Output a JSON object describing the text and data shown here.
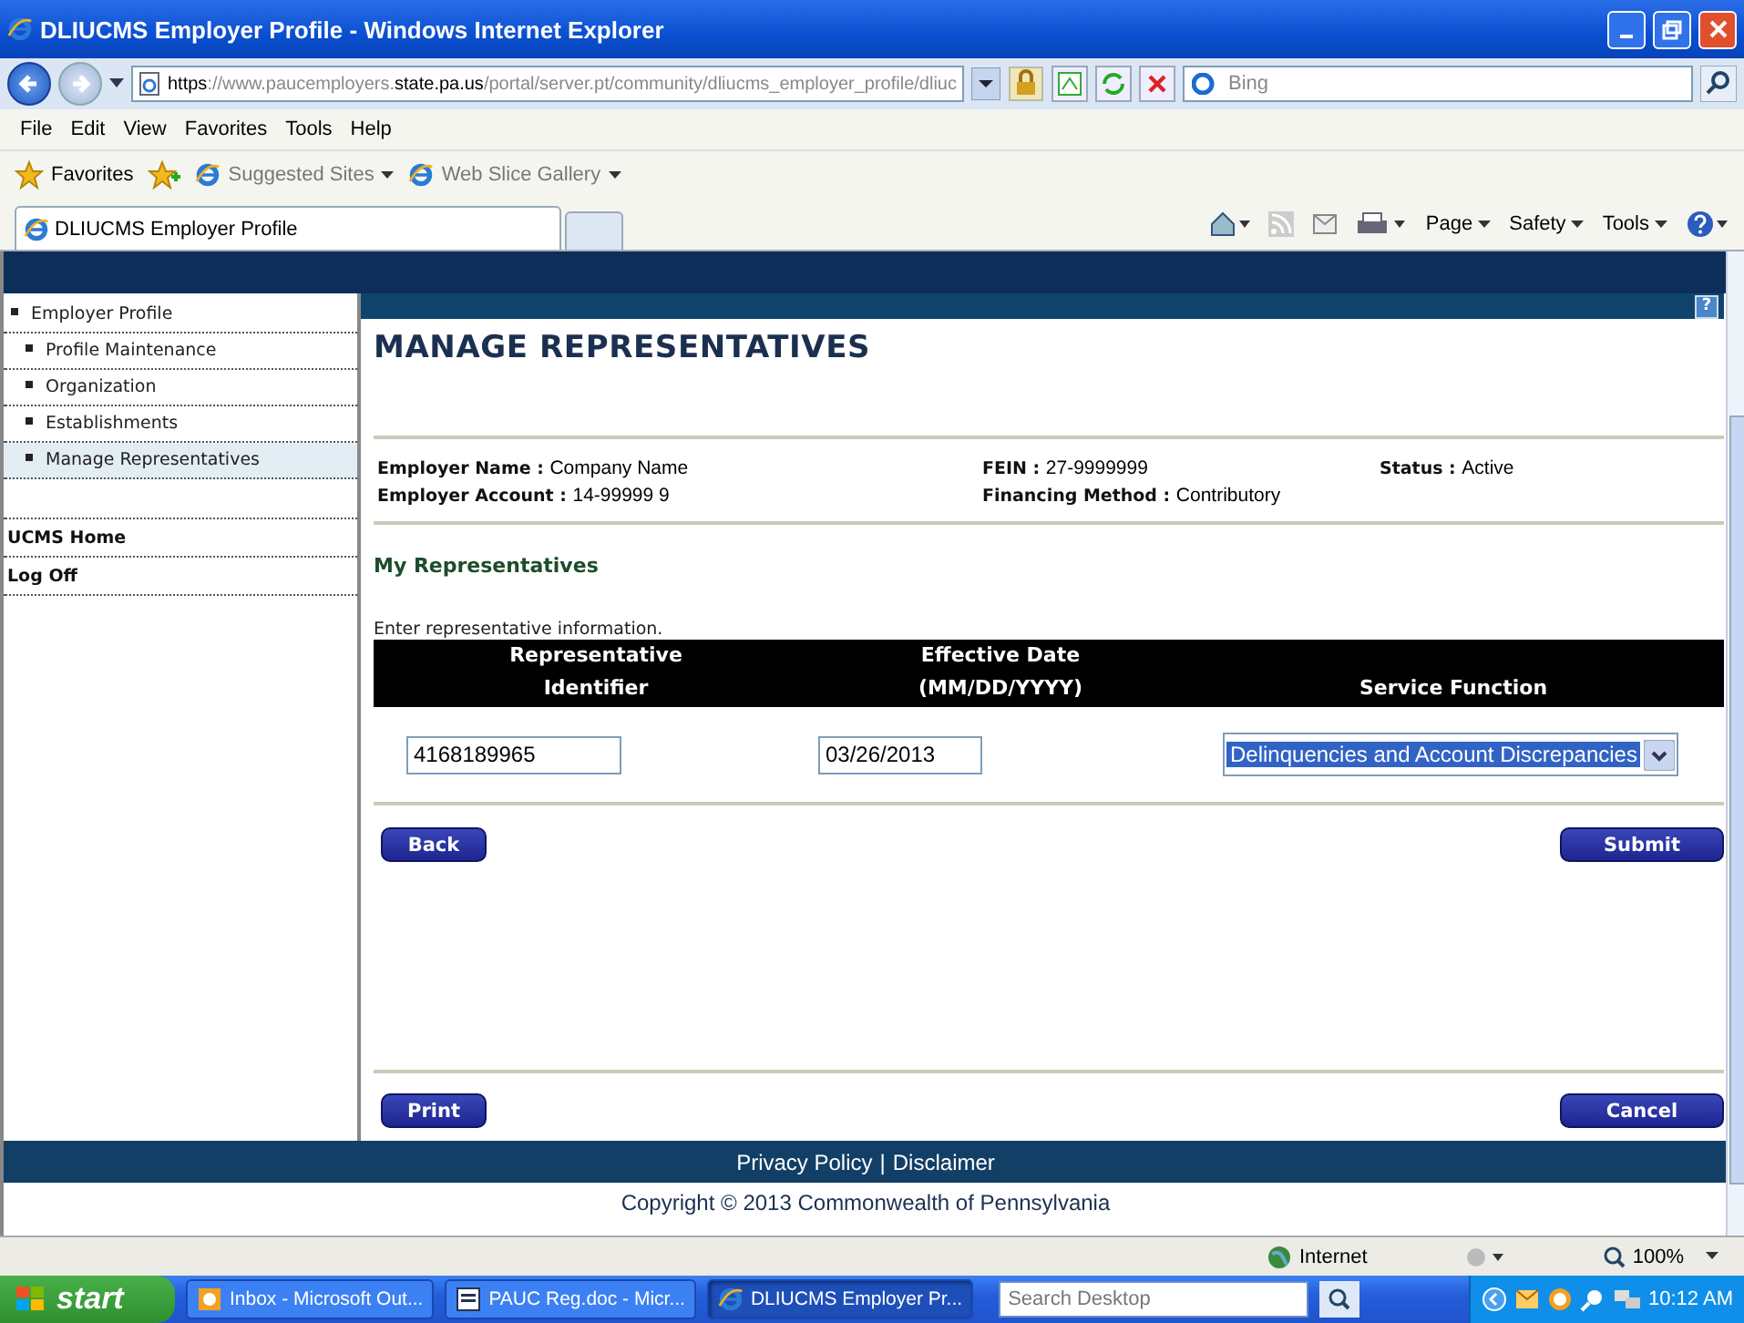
{
  "window": {
    "title": "DLIUCMS Employer Profile - Windows Internet Explorer"
  },
  "address_bar": {
    "url": [
      {
        "text": "https",
        "emphasis": true
      },
      {
        "text": "://www.paucemployers.",
        "emphasis": false
      },
      {
        "text": "state.pa.us",
        "emphasis": true
      },
      {
        "text": "/portal/server.pt/community/dliucms_employer_profile/dliuc",
        "emphasis": false
      }
    ],
    "search_placeholder": "Bing"
  },
  "menu": [
    "File",
    "Edit",
    "View",
    "Favorites",
    "Tools",
    "Help"
  ],
  "favorites_bar": {
    "label": "Favorites",
    "links": [
      "Suggested Sites",
      "Web Slice Gallery"
    ]
  },
  "tabs": [
    {
      "label": "DLIUCMS Employer Profile",
      "selected": true
    }
  ],
  "command_bar": [
    "Page",
    "Safety",
    "Tools"
  ],
  "sidebar": {
    "items": [
      {
        "label": "Employer Profile",
        "selected": false,
        "children": [
          {
            "label": "Profile Maintenance",
            "selected": false
          },
          {
            "label": "Organization",
            "selected": false
          },
          {
            "label": "Establishments",
            "selected": false
          },
          {
            "label": "Manage Representatives",
            "selected": true
          }
        ]
      }
    ],
    "links": [
      "UCMS Home",
      "Log Off"
    ]
  },
  "content": {
    "heading": "MANAGE REPRESENTATIVES",
    "help": "?",
    "employer_info": [
      {
        "label": "Employer Name :",
        "value": "Company Name"
      },
      {
        "label": "FEIN :",
        "value": "27-9999999"
      },
      {
        "label": "Status :",
        "value": "Active"
      },
      {
        "label": "Employer Account :",
        "value": "14-99999 9"
      },
      {
        "label": "Financing Method :",
        "value": "Contributory"
      }
    ],
    "section_title": "My Representatives",
    "instructions": "Enter representative information.",
    "table": {
      "columns": [
        [
          "Representative",
          "Identifier"
        ],
        [
          "Effective Date",
          "(MM/DD/YYYY)"
        ],
        [
          "Service Function"
        ]
      ],
      "row": {
        "identifier": "4168189965",
        "effective_date": "03/26/2013",
        "service_function": "Delinquencies and Account Discrepancies"
      }
    },
    "buttons_top": [
      "Back",
      "Submit"
    ],
    "buttons_bottom": [
      "Print",
      "Cancel"
    ]
  },
  "footer": {
    "links": [
      "Privacy Policy",
      "Disclaimer"
    ],
    "separator": "|",
    "copyright": "Copyright © 2013 Commonwealth of Pennsylvania"
  },
  "status_bar": {
    "zone": "Internet",
    "zoom": "100%"
  },
  "taskbar": {
    "start": "start",
    "tasks": [
      {
        "label": "Inbox - Microsoft Out...",
        "selected": false
      },
      {
        "label": "PAUC Reg.doc - Micr...",
        "selected": false
      },
      {
        "label": "DLIUCMS Employer Pr...",
        "selected": true
      }
    ],
    "search_placeholder": "Search Desktop",
    "clock": "10:12 AM"
  }
}
